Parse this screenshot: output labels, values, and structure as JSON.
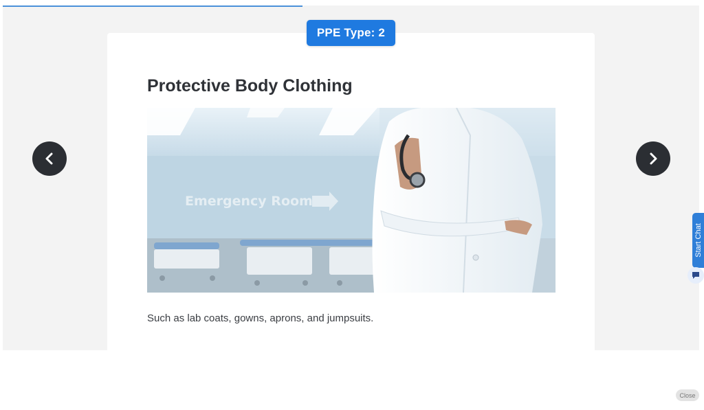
{
  "progress": {
    "fraction": 0.43
  },
  "slide": {
    "badge": "PPE Type: 2",
    "title": "Protective Body Clothing",
    "caption": "Such as lab coats, gowns, aprons, and jumpsuits.",
    "image": {
      "sign_text": "Emergency Room"
    }
  },
  "navigation": {
    "prev_icon": "chevron-left-icon",
    "next_icon": "chevron-right-icon"
  },
  "chat": {
    "tab_label": "Start Chat",
    "icon": "chat-icon"
  },
  "close": {
    "label": "Close"
  },
  "colors": {
    "accent": "#1f7ae0",
    "nav_button": "#2b2e33",
    "chat_tab": "#2f7fd8",
    "progress": "#4a90d9"
  }
}
